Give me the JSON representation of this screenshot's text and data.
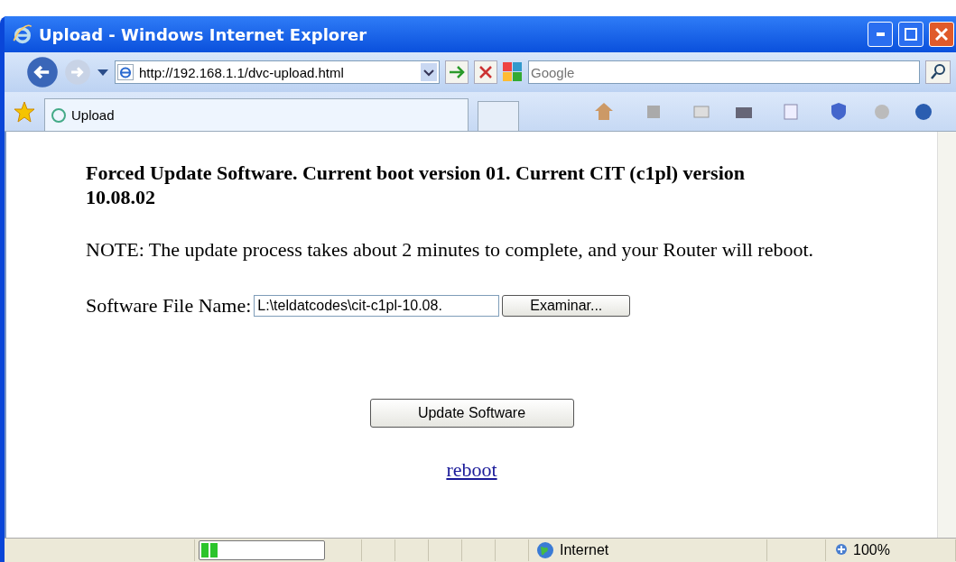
{
  "window": {
    "title": "Upload - Windows Internet Explorer"
  },
  "address_bar": {
    "url": "http://192.168.1.1/dvc-upload.html"
  },
  "search": {
    "placeholder": "Google"
  },
  "tabs": [
    {
      "label": "Upload",
      "selected": true
    }
  ],
  "page": {
    "heading": "Forced Update Software. Current boot version 01. Current CIT (c1pl) version 10.08.02",
    "note": "NOTE: The update process takes about 2 minutes to complete, and your Router will reboot.",
    "file_label": "Software File Name:",
    "file_value": "L:\\teldatcodes\\cit-c1pl-10.08.",
    "browse_button": "Examinar...",
    "submit_button": "Update Software",
    "reboot_link": "reboot"
  },
  "status_bar": {
    "progress": {
      "level": 0.15
    },
    "zone": "Internet",
    "zoom": "100%"
  }
}
